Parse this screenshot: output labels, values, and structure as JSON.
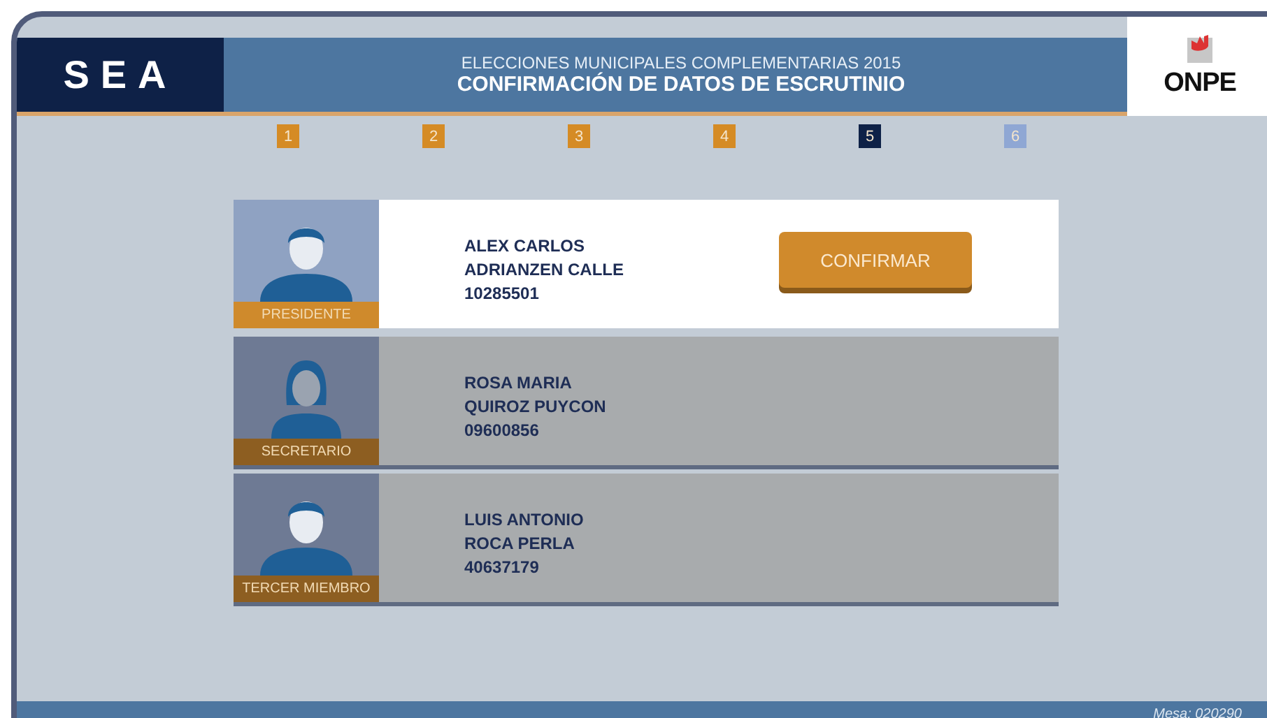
{
  "header": {
    "logo": "SEA",
    "subtitle": "ELECCIONES MUNICIPALES COMPLEMENTARIAS 2015",
    "title": "CONFIRMACIÓN DE DATOS DE ESCRUTINIO",
    "partner_logo": "ONPE"
  },
  "steps": [
    {
      "label": "1",
      "kind": "done"
    },
    {
      "label": "2",
      "kind": "done"
    },
    {
      "label": "3",
      "kind": "done"
    },
    {
      "label": "4",
      "kind": "done"
    },
    {
      "label": "5",
      "kind": "current"
    },
    {
      "label": "6",
      "kind": "pending"
    }
  ],
  "members": [
    {
      "role": "PRESIDENTE",
      "kind": "male",
      "names": "ALEX CARLOS",
      "surnames": "ADRIANZEN CALLE",
      "dni": "10285501",
      "active": true,
      "button": "CONFIRMAR"
    },
    {
      "role": "SECRETARIO",
      "kind": "female",
      "names": "ROSA MARIA",
      "surnames": "QUIROZ PUYCON",
      "dni": "09600856",
      "active": false
    },
    {
      "role": "TERCER MIEMBRO",
      "kind": "male",
      "names": "LUIS ANTONIO",
      "surnames": "ROCA PERLA",
      "dni": "40637179",
      "active": false
    }
  ],
  "footer": {
    "table": "Mesa: 020290"
  }
}
